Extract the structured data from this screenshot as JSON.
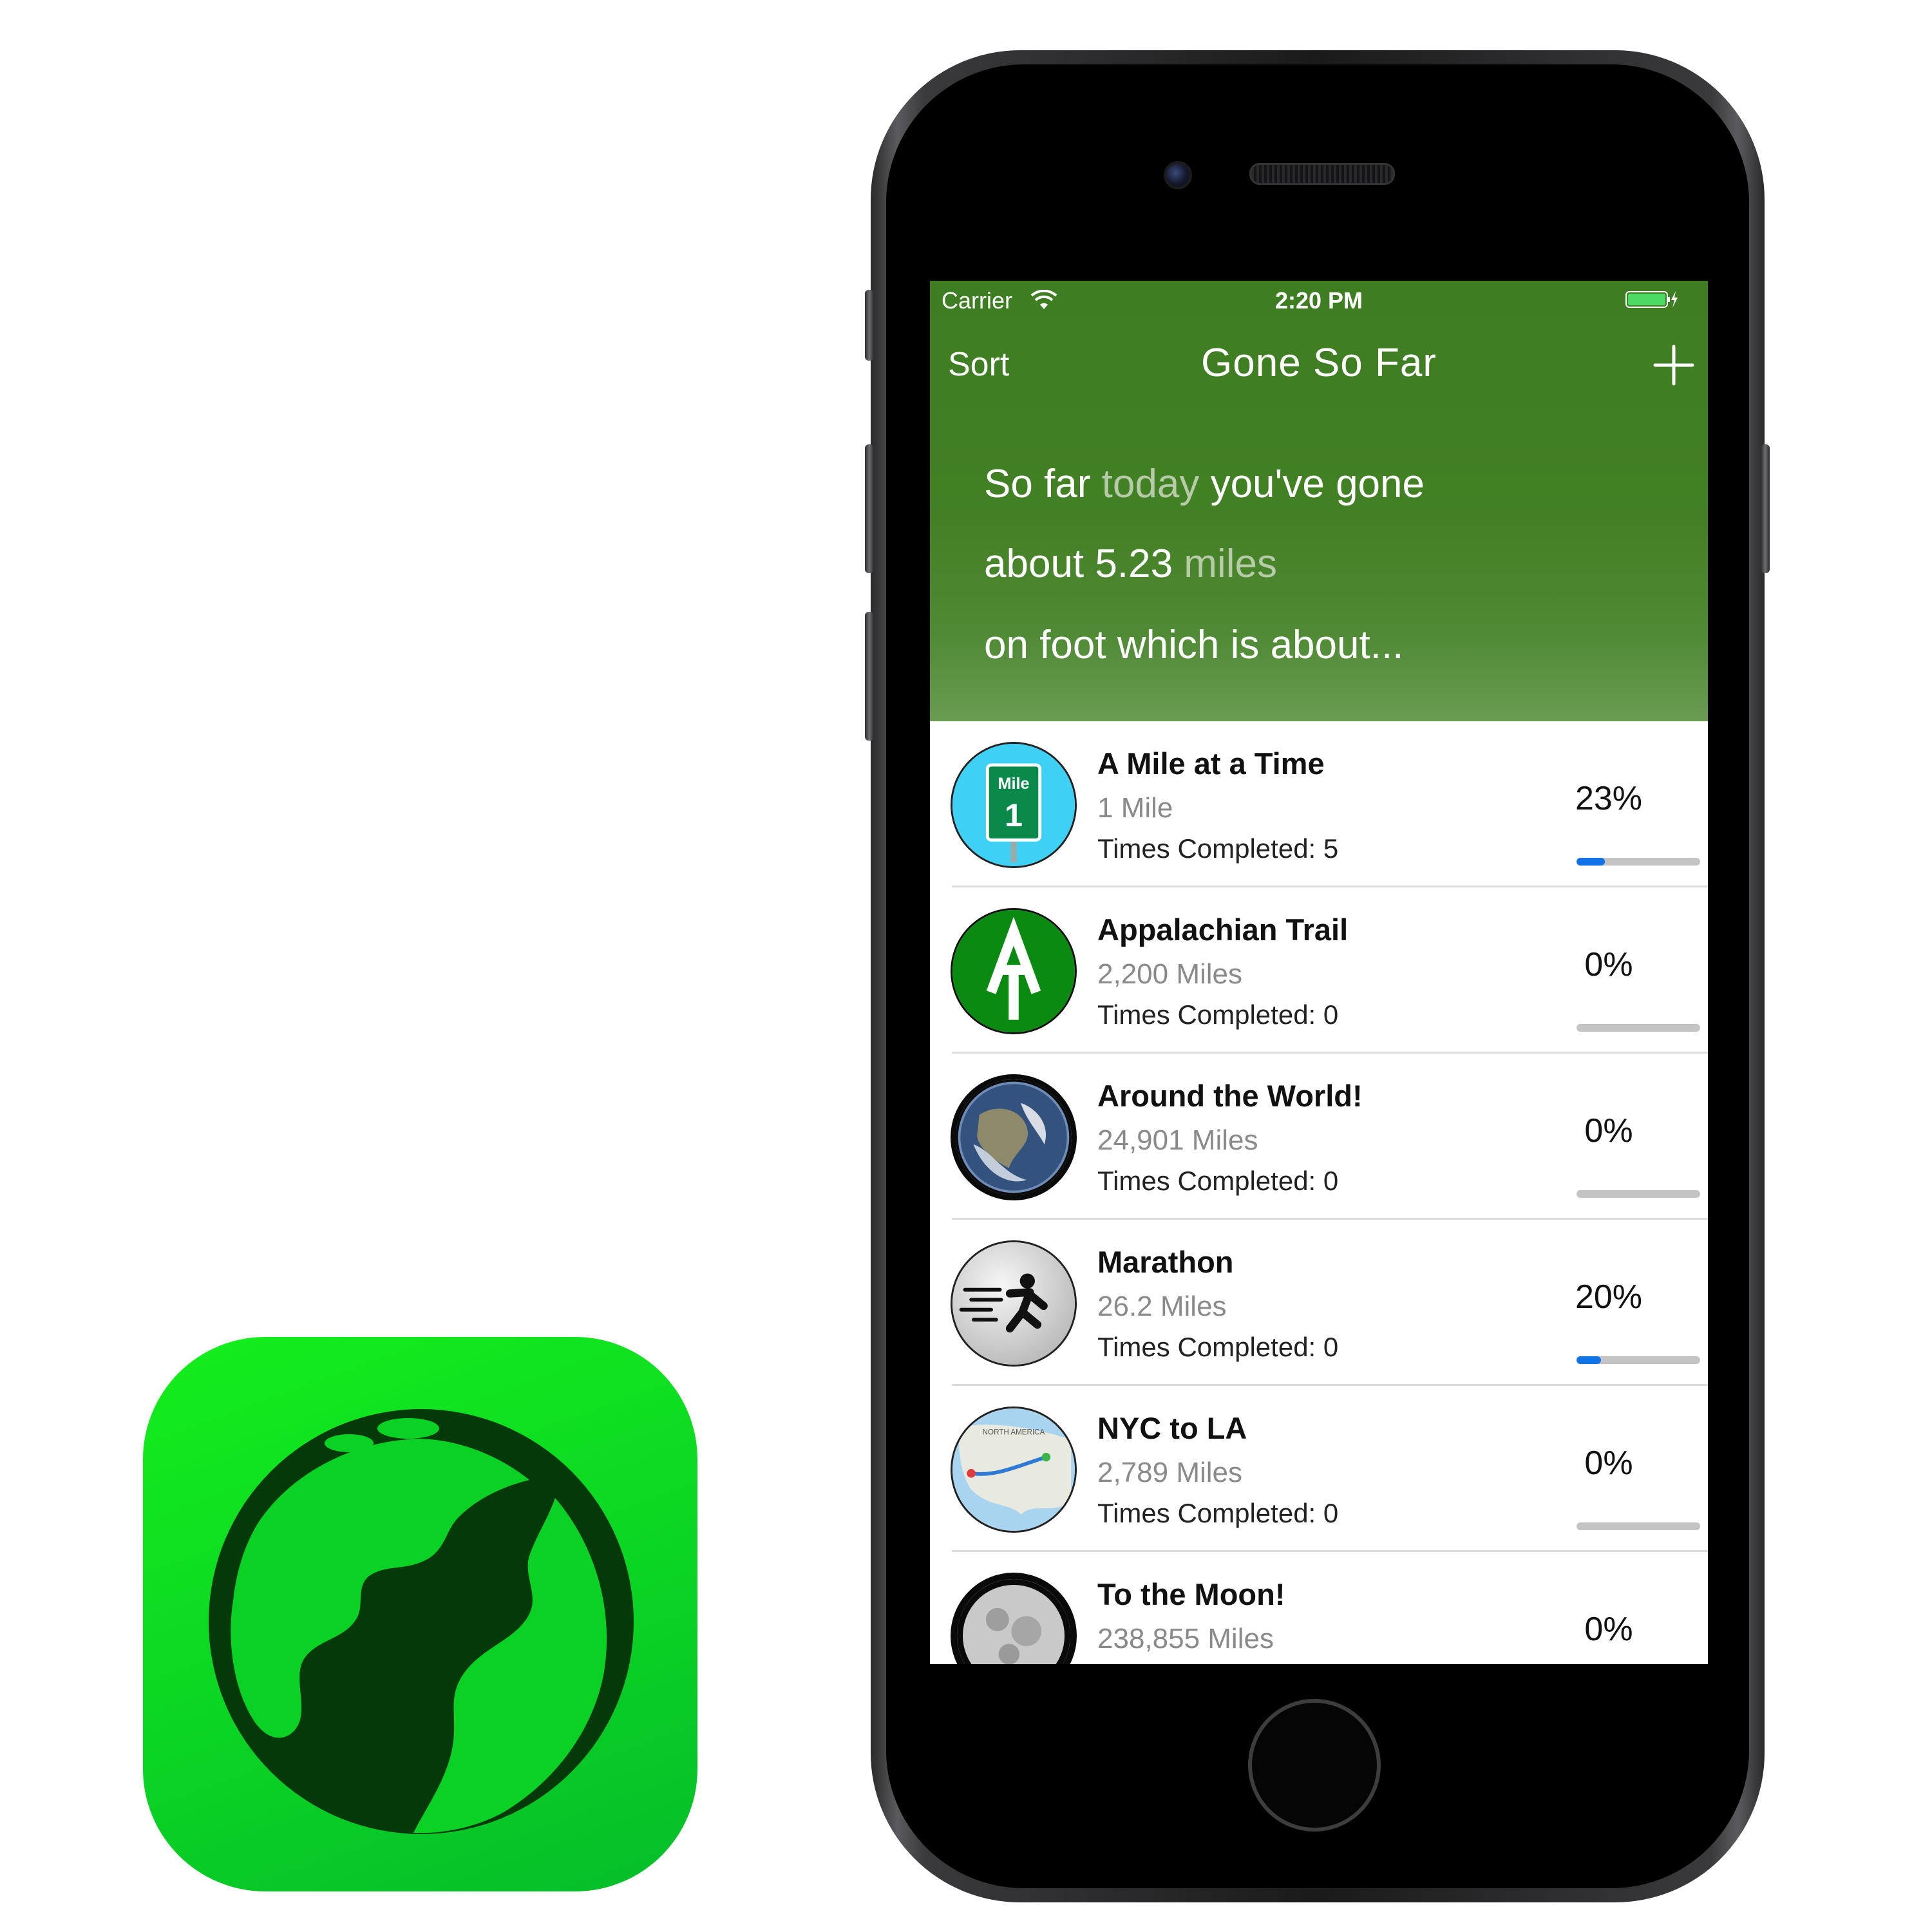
{
  "status_bar": {
    "carrier": "Carrier",
    "time": "2:20 PM",
    "wifi_icon": "wifi-icon",
    "battery_icon": "battery-charging-icon",
    "battery_color": "#4cd964"
  },
  "nav": {
    "sort_label": "Sort",
    "title": "Gone So Far",
    "add_icon": "plus-icon"
  },
  "summary": {
    "line1_prefix": "So far",
    "line1_highlight": "today",
    "line1_suffix": "you've gone",
    "line2_prefix": "about 5.23",
    "line2_highlight": "miles",
    "line3": "on foot which is about..."
  },
  "colors": {
    "header_green": "#3e7d22",
    "progress_blue": "#1273e8",
    "app_icon_green": "#0ad224",
    "globe_dark": "#043a0a"
  },
  "goals": [
    {
      "title": "A Mile at a Time",
      "distance": "1 Mile",
      "times": "Times Completed: 5",
      "percent": "23%",
      "progress": 0.23,
      "icon": "mile-marker-icon"
    },
    {
      "title": "Appalachian Trail",
      "distance": "2,200 Miles",
      "times": "Times Completed: 0",
      "percent": "0%",
      "progress": 0.0,
      "icon": "appalachian-trail-icon"
    },
    {
      "title": "Around the World!",
      "distance": "24,901 Miles",
      "times": "Times Completed: 0",
      "percent": "0%",
      "progress": 0.0,
      "icon": "earth-icon"
    },
    {
      "title": "Marathon",
      "distance": "26.2 Miles",
      "times": "Times Completed: 0",
      "percent": "20%",
      "progress": 0.2,
      "icon": "runner-icon"
    },
    {
      "title": "NYC to LA",
      "distance": "2,789 Miles",
      "times": "Times Completed: 0",
      "percent": "0%",
      "progress": 0.0,
      "icon": "map-route-icon",
      "map_label": "NORTH AMERICA"
    },
    {
      "title": "To the Moon!",
      "distance": "238,855 Miles",
      "times": "",
      "percent": "0%",
      "progress": 0.0,
      "icon": "moon-icon"
    }
  ],
  "mile_sign": {
    "top": "Mile",
    "number": "1"
  }
}
